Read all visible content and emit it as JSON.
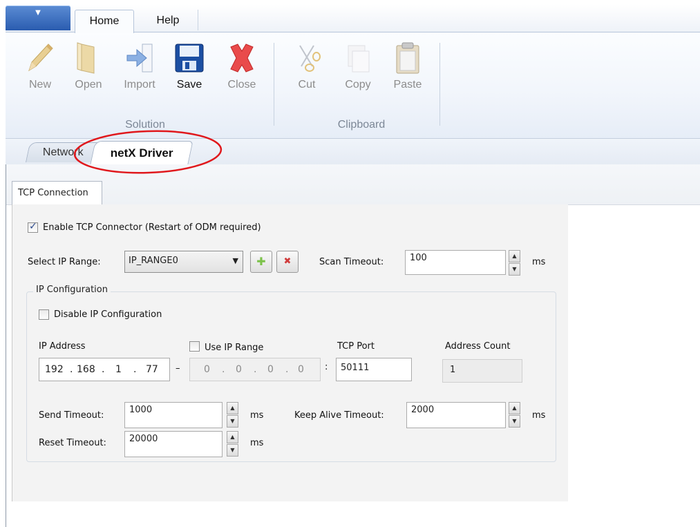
{
  "ribbon": {
    "tabs": [
      {
        "label": "Home",
        "active": true
      },
      {
        "label": "Help",
        "active": false
      }
    ],
    "solution_group": {
      "label": "Solution",
      "buttons": [
        {
          "label": "New",
          "icon": "pencil-icon",
          "enabled": false
        },
        {
          "label": "Open",
          "icon": "folder-icon",
          "enabled": false
        },
        {
          "label": "Import",
          "icon": "import-arrow-icon",
          "enabled": false
        },
        {
          "label": "Save",
          "icon": "floppy-disk-icon",
          "enabled": true
        },
        {
          "label": "Close",
          "icon": "red-x-icon",
          "enabled": false
        }
      ]
    },
    "clipboard_group": {
      "label": "Clipboard",
      "buttons": [
        {
          "label": "Cut",
          "icon": "scissors-icon",
          "enabled": false
        },
        {
          "label": "Copy",
          "icon": "copy-icon",
          "enabled": false
        },
        {
          "label": "Paste",
          "icon": "clipboard-icon",
          "enabled": false
        }
      ]
    }
  },
  "doc_tabs": [
    {
      "label": "Network",
      "active": false
    },
    {
      "label": "netX Driver",
      "active": true
    }
  ],
  "annotation": {
    "color": "#e0181c",
    "shape": "ellipse"
  },
  "inner_tab": {
    "label": "TCP Connection"
  },
  "form": {
    "enable_tcp": {
      "label": "Enable TCP Connector (Restart of ODM required)",
      "checked": true
    },
    "select_ip_range": {
      "label": "Select IP Range:",
      "value": "IP_RANGE0"
    },
    "scan_timeout": {
      "label": "Scan Timeout:",
      "value": "100",
      "unit": "ms"
    },
    "ip_config": {
      "legend": "IP Configuration",
      "disable_ip": {
        "label": "Disable IP Configuration",
        "checked": false
      },
      "ip_address": {
        "label": "IP Address",
        "o1": "192",
        "o2": "168",
        "o3": "1",
        "o4": "77"
      },
      "dash": "–",
      "use_ip_range": {
        "label": "Use IP Range",
        "checked": false,
        "o1": "0",
        "o2": "0",
        "o3": "0",
        "o4": "0"
      },
      "colon": ":",
      "tcp_port": {
        "label": "TCP Port",
        "value": "50111"
      },
      "address_count": {
        "label": "Address Count",
        "value": "1"
      },
      "send_timeout": {
        "label": "Send Timeout:",
        "value": "1000",
        "unit": "ms"
      },
      "reset_timeout": {
        "label": "Reset Timeout:",
        "value": "20000",
        "unit": "ms"
      },
      "keep_alive": {
        "label": "Keep Alive Timeout:",
        "value": "2000",
        "unit": "ms"
      }
    }
  },
  "colors": {
    "accent_blue": "#2a5caf",
    "ribbon_bg": "#f1f5fb",
    "panel_bg": "#f3f3f3"
  }
}
